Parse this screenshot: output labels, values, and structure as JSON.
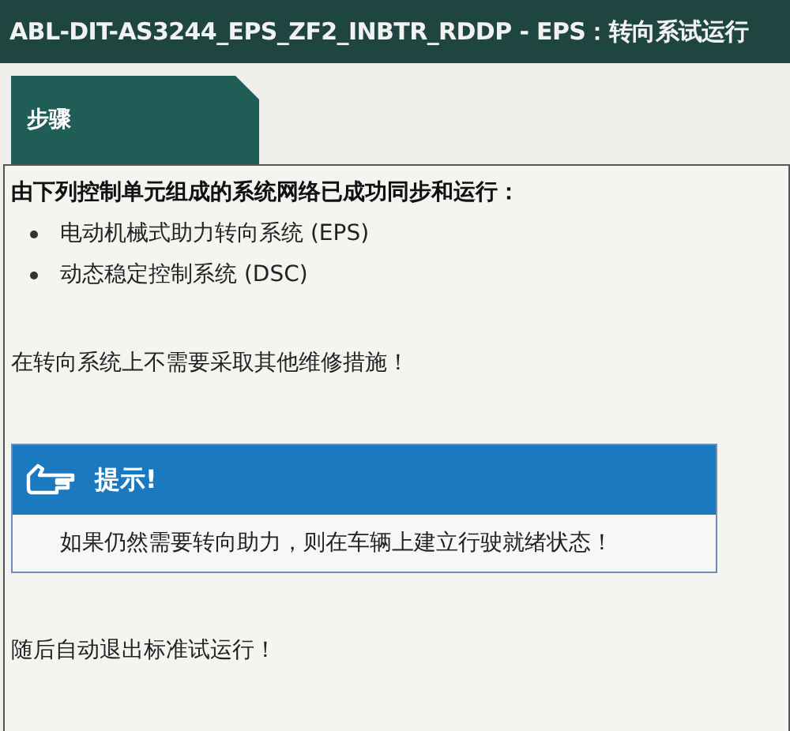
{
  "window": {
    "title": "ABL-DIT-AS3244_EPS_ZF2_INBTR_RDDP - EPS：转向系试运行"
  },
  "tabs": [
    {
      "label": "步骤",
      "selected": true
    }
  ],
  "content": {
    "intro": "由下列控制单元组成的系统网络已成功同步和运行：",
    "items": [
      "电动机械式助力转向系统 (EPS)",
      "动态稳定控制系统 (DSC)"
    ],
    "message": "在转向系统上不需要采取其他维修措施！",
    "hint": {
      "title": "提示!",
      "text": "如果仍然需要转向助力，则在车辆上建立行驶就绪状态！"
    },
    "footer": "随后自动退出标准试运行！"
  }
}
